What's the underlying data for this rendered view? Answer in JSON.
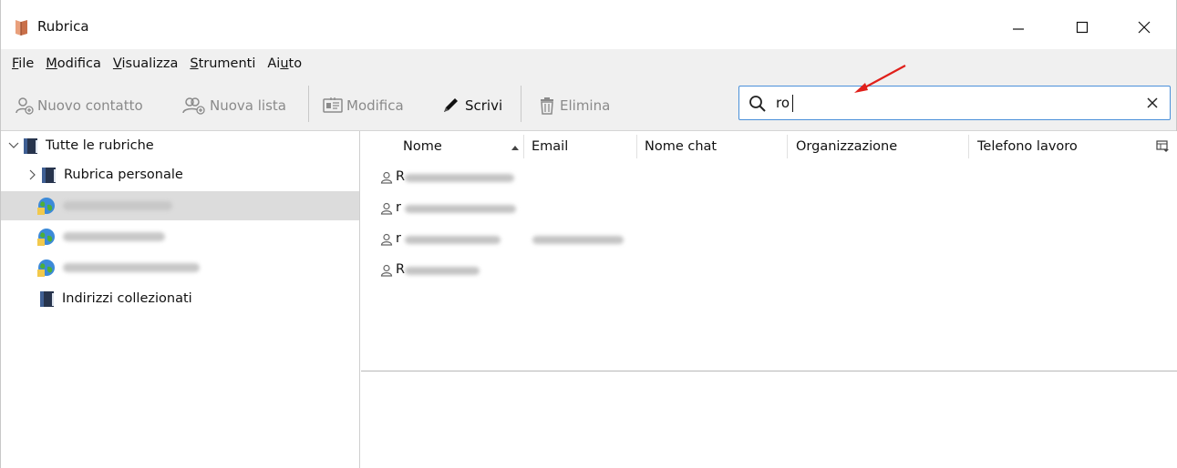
{
  "window": {
    "title": "Rubrica"
  },
  "menu": {
    "items": [
      {
        "pre": "",
        "u": "F",
        "post": "ile"
      },
      {
        "pre": "",
        "u": "M",
        "post": "odifica"
      },
      {
        "pre": "",
        "u": "V",
        "post": "isualizza"
      },
      {
        "pre": "",
        "u": "S",
        "post": "trumenti"
      },
      {
        "pre": "Ai",
        "u": "u",
        "post": "to"
      }
    ]
  },
  "toolbar": {
    "new_contact": "Nuovo contatto",
    "new_list": "Nuova lista",
    "edit": "Modifica",
    "write": "Scrivi",
    "delete": "Elimina"
  },
  "search": {
    "value": "ro"
  },
  "tree": {
    "all": "Tutte le rubriche",
    "personal": "Rubrica personale",
    "collected": "Indirizzi collezionati"
  },
  "columns": {
    "name": "Nome",
    "email": "Email",
    "chat": "Nome chat",
    "org": "Organizzazione",
    "phone": "Telefono lavoro"
  },
  "rows": [
    {
      "initial": "R"
    },
    {
      "initial": "r"
    },
    {
      "initial": "r"
    },
    {
      "initial": "R"
    }
  ],
  "colors": {
    "accent": "#4a90d9",
    "menu_bg": "#f0f0f0",
    "selected_bg": "#dcdcdc",
    "arrow": "#e0201b"
  }
}
